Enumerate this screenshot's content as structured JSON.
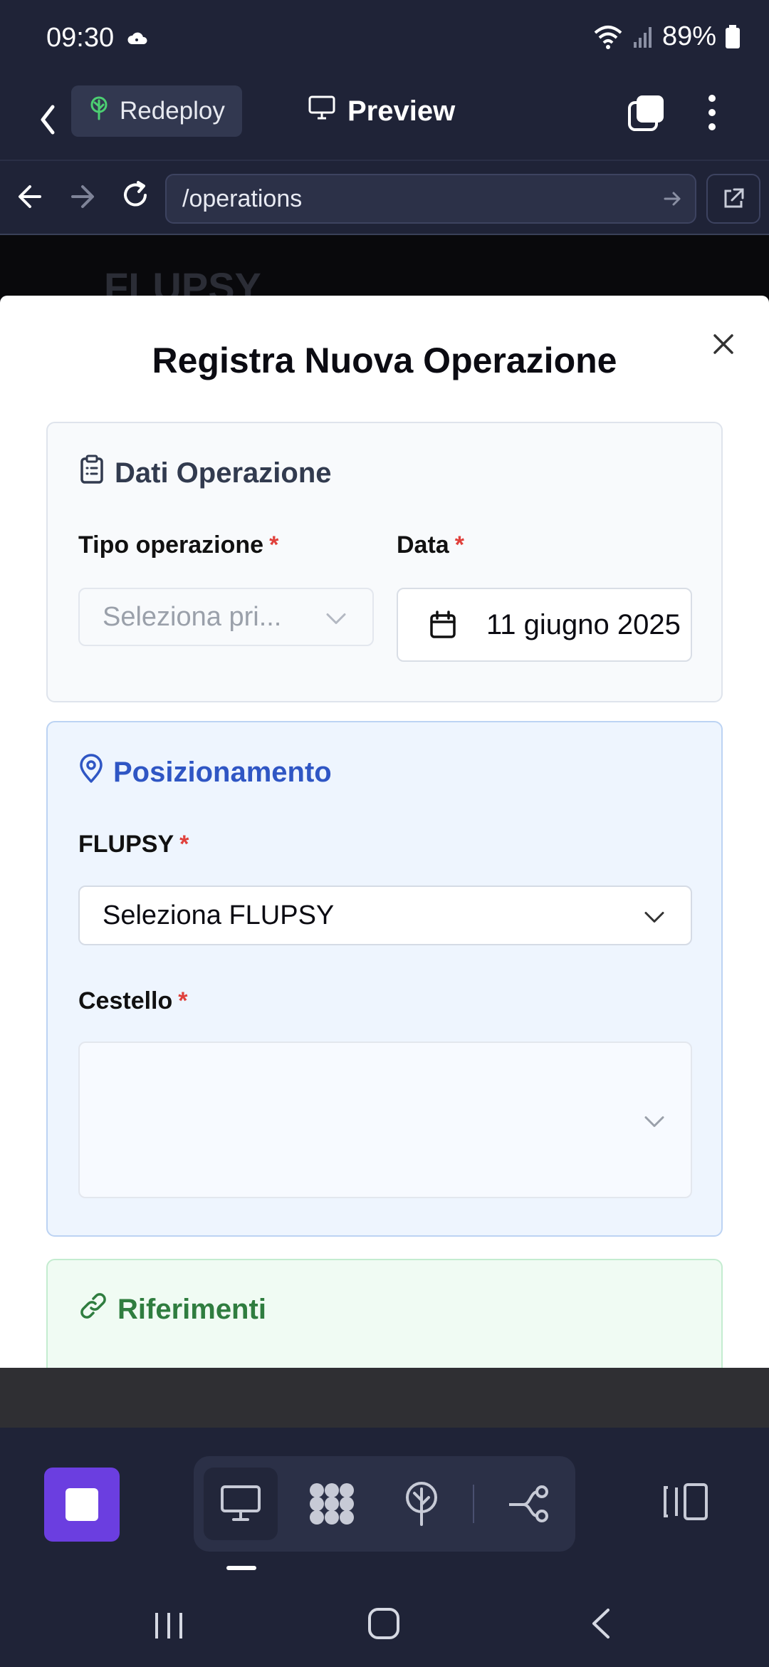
{
  "status_bar": {
    "time": "09:30",
    "battery": "89%",
    "icons": [
      "cloud-icon",
      "wifi-icon",
      "signal-icon",
      "battery-icon"
    ]
  },
  "header": {
    "project_label": "Redeploy",
    "view_label": "Preview"
  },
  "url_bar": {
    "url": "/operations"
  },
  "background_page": {
    "title": "FLUPSY"
  },
  "modal": {
    "title": "Registra Nuova Operazione",
    "sections": {
      "operation": {
        "heading": "Dati Operazione",
        "type_label": "Tipo operazione",
        "type_placeholder": "Seleziona pri...",
        "date_label": "Data",
        "date_value": "11 giugno 2025"
      },
      "position": {
        "heading": "Posizionamento",
        "flupsy_label": "FLUPSY",
        "flupsy_value": "Seleziona FLUPSY",
        "basket_label": "Cestello",
        "basket_value": ""
      },
      "references": {
        "heading": "Riferimenti"
      }
    },
    "required_marker": "*"
  },
  "colors": {
    "app_bg": "#1f2337",
    "accent": "#6b3ee0",
    "position_accent": "#2f56c4",
    "references_accent": "#2f7d3f",
    "required": "#e0403b"
  }
}
